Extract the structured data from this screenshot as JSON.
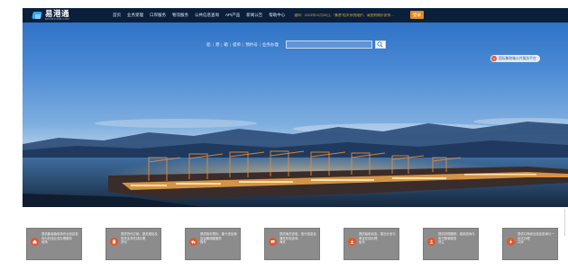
{
  "app": {
    "logo_name": "易港通",
    "logo_sub": "EPORTHUB.COM"
  },
  "nav": {
    "items": [
      {
        "label": "首页"
      },
      {
        "label": "业务受理"
      },
      {
        "label": "口岸服务"
      },
      {
        "label": "物流服务"
      },
      {
        "label": "公共信息查询"
      },
      {
        "label": "API产品"
      },
      {
        "label": "新闻公告"
      },
      {
        "label": "帮助中心"
      }
    ],
    "notice": "通知：2023年10月26日，\"集港\"相关系统维护，请提前做好安排 ...",
    "login_label": "登录"
  },
  "search": {
    "tabs": [
      "船",
      "港",
      "箱",
      "提单",
      "预约号",
      "业务办理"
    ],
    "placeholder": "",
    "value": ""
  },
  "side_badge": {
    "text": "国际集装箱公共服务平台"
  },
  "cards": [
    {
      "title": "堆场",
      "desc": "提供集装箱堆场作业信息查询与在线业务办理服务"
    },
    {
      "title": "货代",
      "desc": "提供货代订舱、报关报检及相关业务在线办理"
    },
    {
      "title": "拖车",
      "desc": "提供拖车预约、集卡进出港及运输调度服务"
    },
    {
      "title": "海关",
      "desc": "提供海关查验、放行信息及通关状态查询"
    },
    {
      "title": "船代",
      "desc": "提供船舶动态、靠泊计划与单证在线办理"
    },
    {
      "title": "货主",
      "desc": "提供货物跟踪、费用查询与电子账单服务"
    },
    {
      "title": "口岸",
      "desc": "提供口岸综合信息查询与一站式办理"
    }
  ],
  "colors": {
    "nav_bg": "#0a1f3a",
    "accent": "#e58a1f",
    "card_bg": "#8c8c8c",
    "card_icon": "#e0572c",
    "notice": "#e2a23a"
  },
  "icons": {
    "search": "search-icon",
    "cards": [
      "warehouse-icon",
      "building-icon",
      "truck-icon",
      "chat-icon",
      "download-icon",
      "user-icon",
      "arrow-down-icon"
    ]
  }
}
